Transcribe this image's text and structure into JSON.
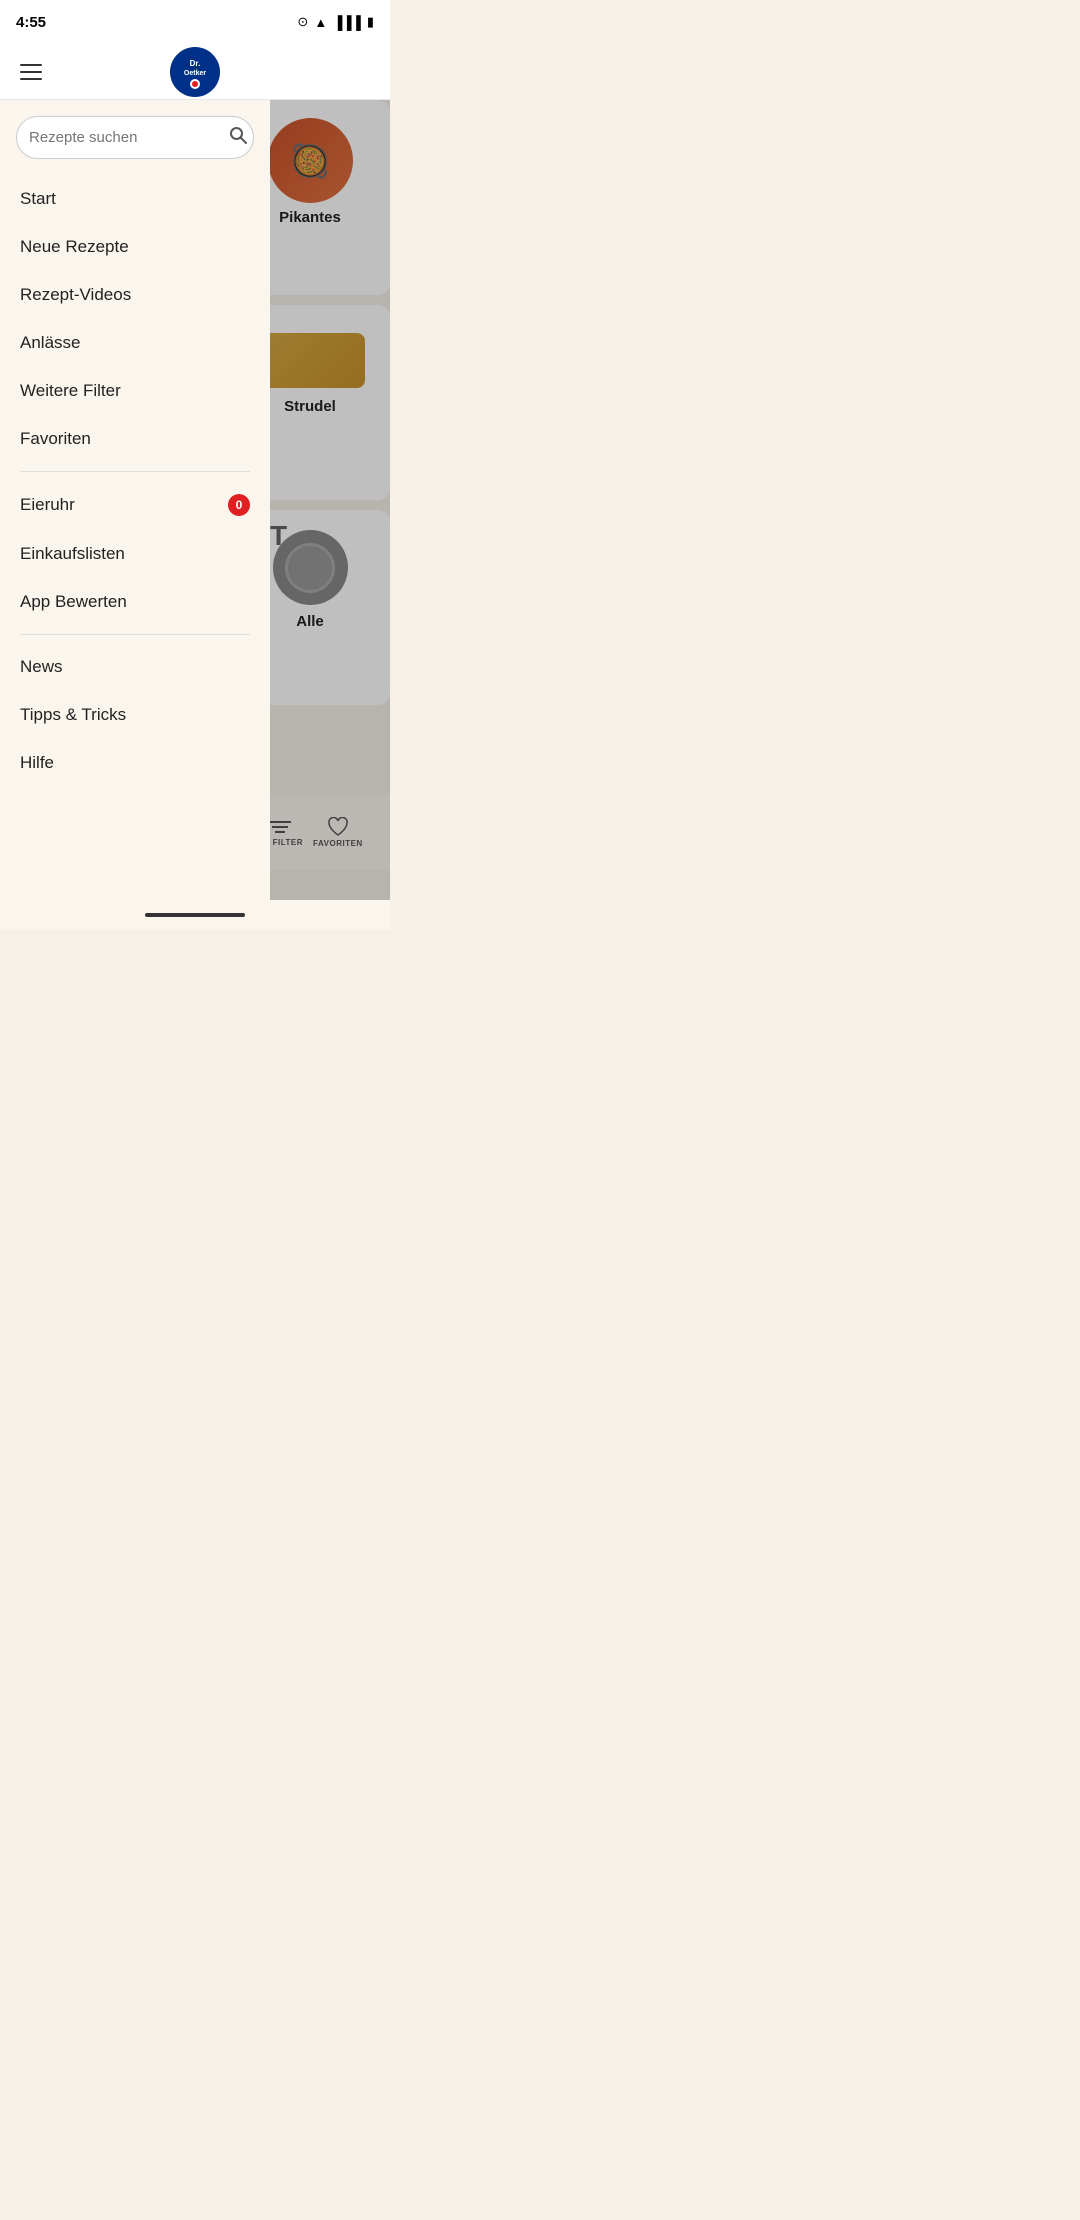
{
  "statusBar": {
    "time": "4:55",
    "icons": [
      "face-id",
      "wifi",
      "signal",
      "battery"
    ]
  },
  "header": {
    "logoAlt": "Dr. Oetker",
    "menuAriaLabel": "Menu"
  },
  "search": {
    "placeholder": "Rezepte suchen"
  },
  "navItems": [
    {
      "id": "start",
      "label": "Start",
      "badge": null
    },
    {
      "id": "neue-rezepte",
      "label": "Neue Rezepte",
      "badge": null
    },
    {
      "id": "rezept-videos",
      "label": "Rezept-Videos",
      "badge": null
    },
    {
      "id": "anlaesse",
      "label": "Anlässe",
      "badge": null
    },
    {
      "id": "weitere-filter",
      "label": "Weitere Filter",
      "badge": null
    },
    {
      "id": "favoriten",
      "label": "Favoriten",
      "badge": null
    }
  ],
  "navItems2": [
    {
      "id": "eieruhr",
      "label": "Eieruhr",
      "badge": "0"
    },
    {
      "id": "einkaufslisten",
      "label": "Einkaufslisten",
      "badge": null
    },
    {
      "id": "app-bewerten",
      "label": "App Bewerten",
      "badge": null
    }
  ],
  "navItems3": [
    {
      "id": "news",
      "label": "News",
      "badge": null
    },
    {
      "id": "tipps-tricks",
      "label": "Tipps & Tricks",
      "badge": null
    },
    {
      "id": "hilfe",
      "label": "Hilfe",
      "badge": null
    }
  ],
  "foodCards": [
    {
      "id": "pikantes",
      "label": "Pikantes",
      "emoji": "🥘"
    },
    {
      "id": "strudel",
      "label": "Strudel",
      "type": "strudel"
    },
    {
      "id": "alle",
      "label": "Alle",
      "type": "alle"
    }
  ],
  "bottomBar": {
    "filterLabel": "HR FILTER",
    "favoritenLabel": "FAVORITEN"
  },
  "homeIndicator": {}
}
